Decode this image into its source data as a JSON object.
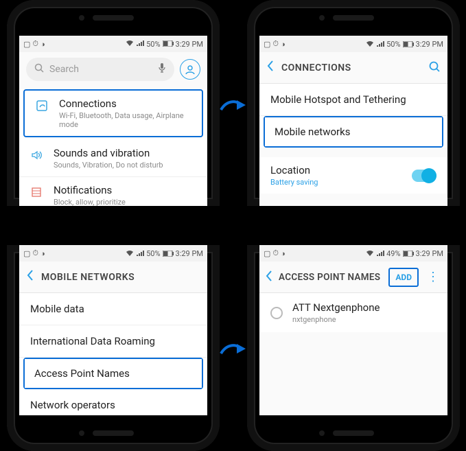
{
  "status": {
    "battery": "50%",
    "battery2": "49%",
    "time": "3:29 PM"
  },
  "screen1": {
    "search_placeholder": "Search",
    "rows": [
      {
        "title": "Connections",
        "sub": "Wi-Fi, Bluetooth, Data usage, Airplane mode"
      },
      {
        "title": "Sounds and vibration",
        "sub": "Sounds, Vibration, Do not disturb"
      },
      {
        "title": "Notifications",
        "sub": "Block, allow, prioritize"
      }
    ]
  },
  "screen2": {
    "title": "CONNECTIONS",
    "row1": "Mobile Hotspot and Tethering",
    "row2": "Mobile networks",
    "loc_title": "Location",
    "loc_sub": "Battery saving"
  },
  "screen3": {
    "title": "MOBILE NETWORKS",
    "rows": [
      "Mobile data",
      "International Data Roaming",
      "Access Point Names",
      "Network operators"
    ]
  },
  "screen4": {
    "title": "ACCESS POINT NAMES",
    "add": "ADD",
    "apn_title": "ATT Nextgenphone",
    "apn_sub": "nxtgenphone"
  }
}
